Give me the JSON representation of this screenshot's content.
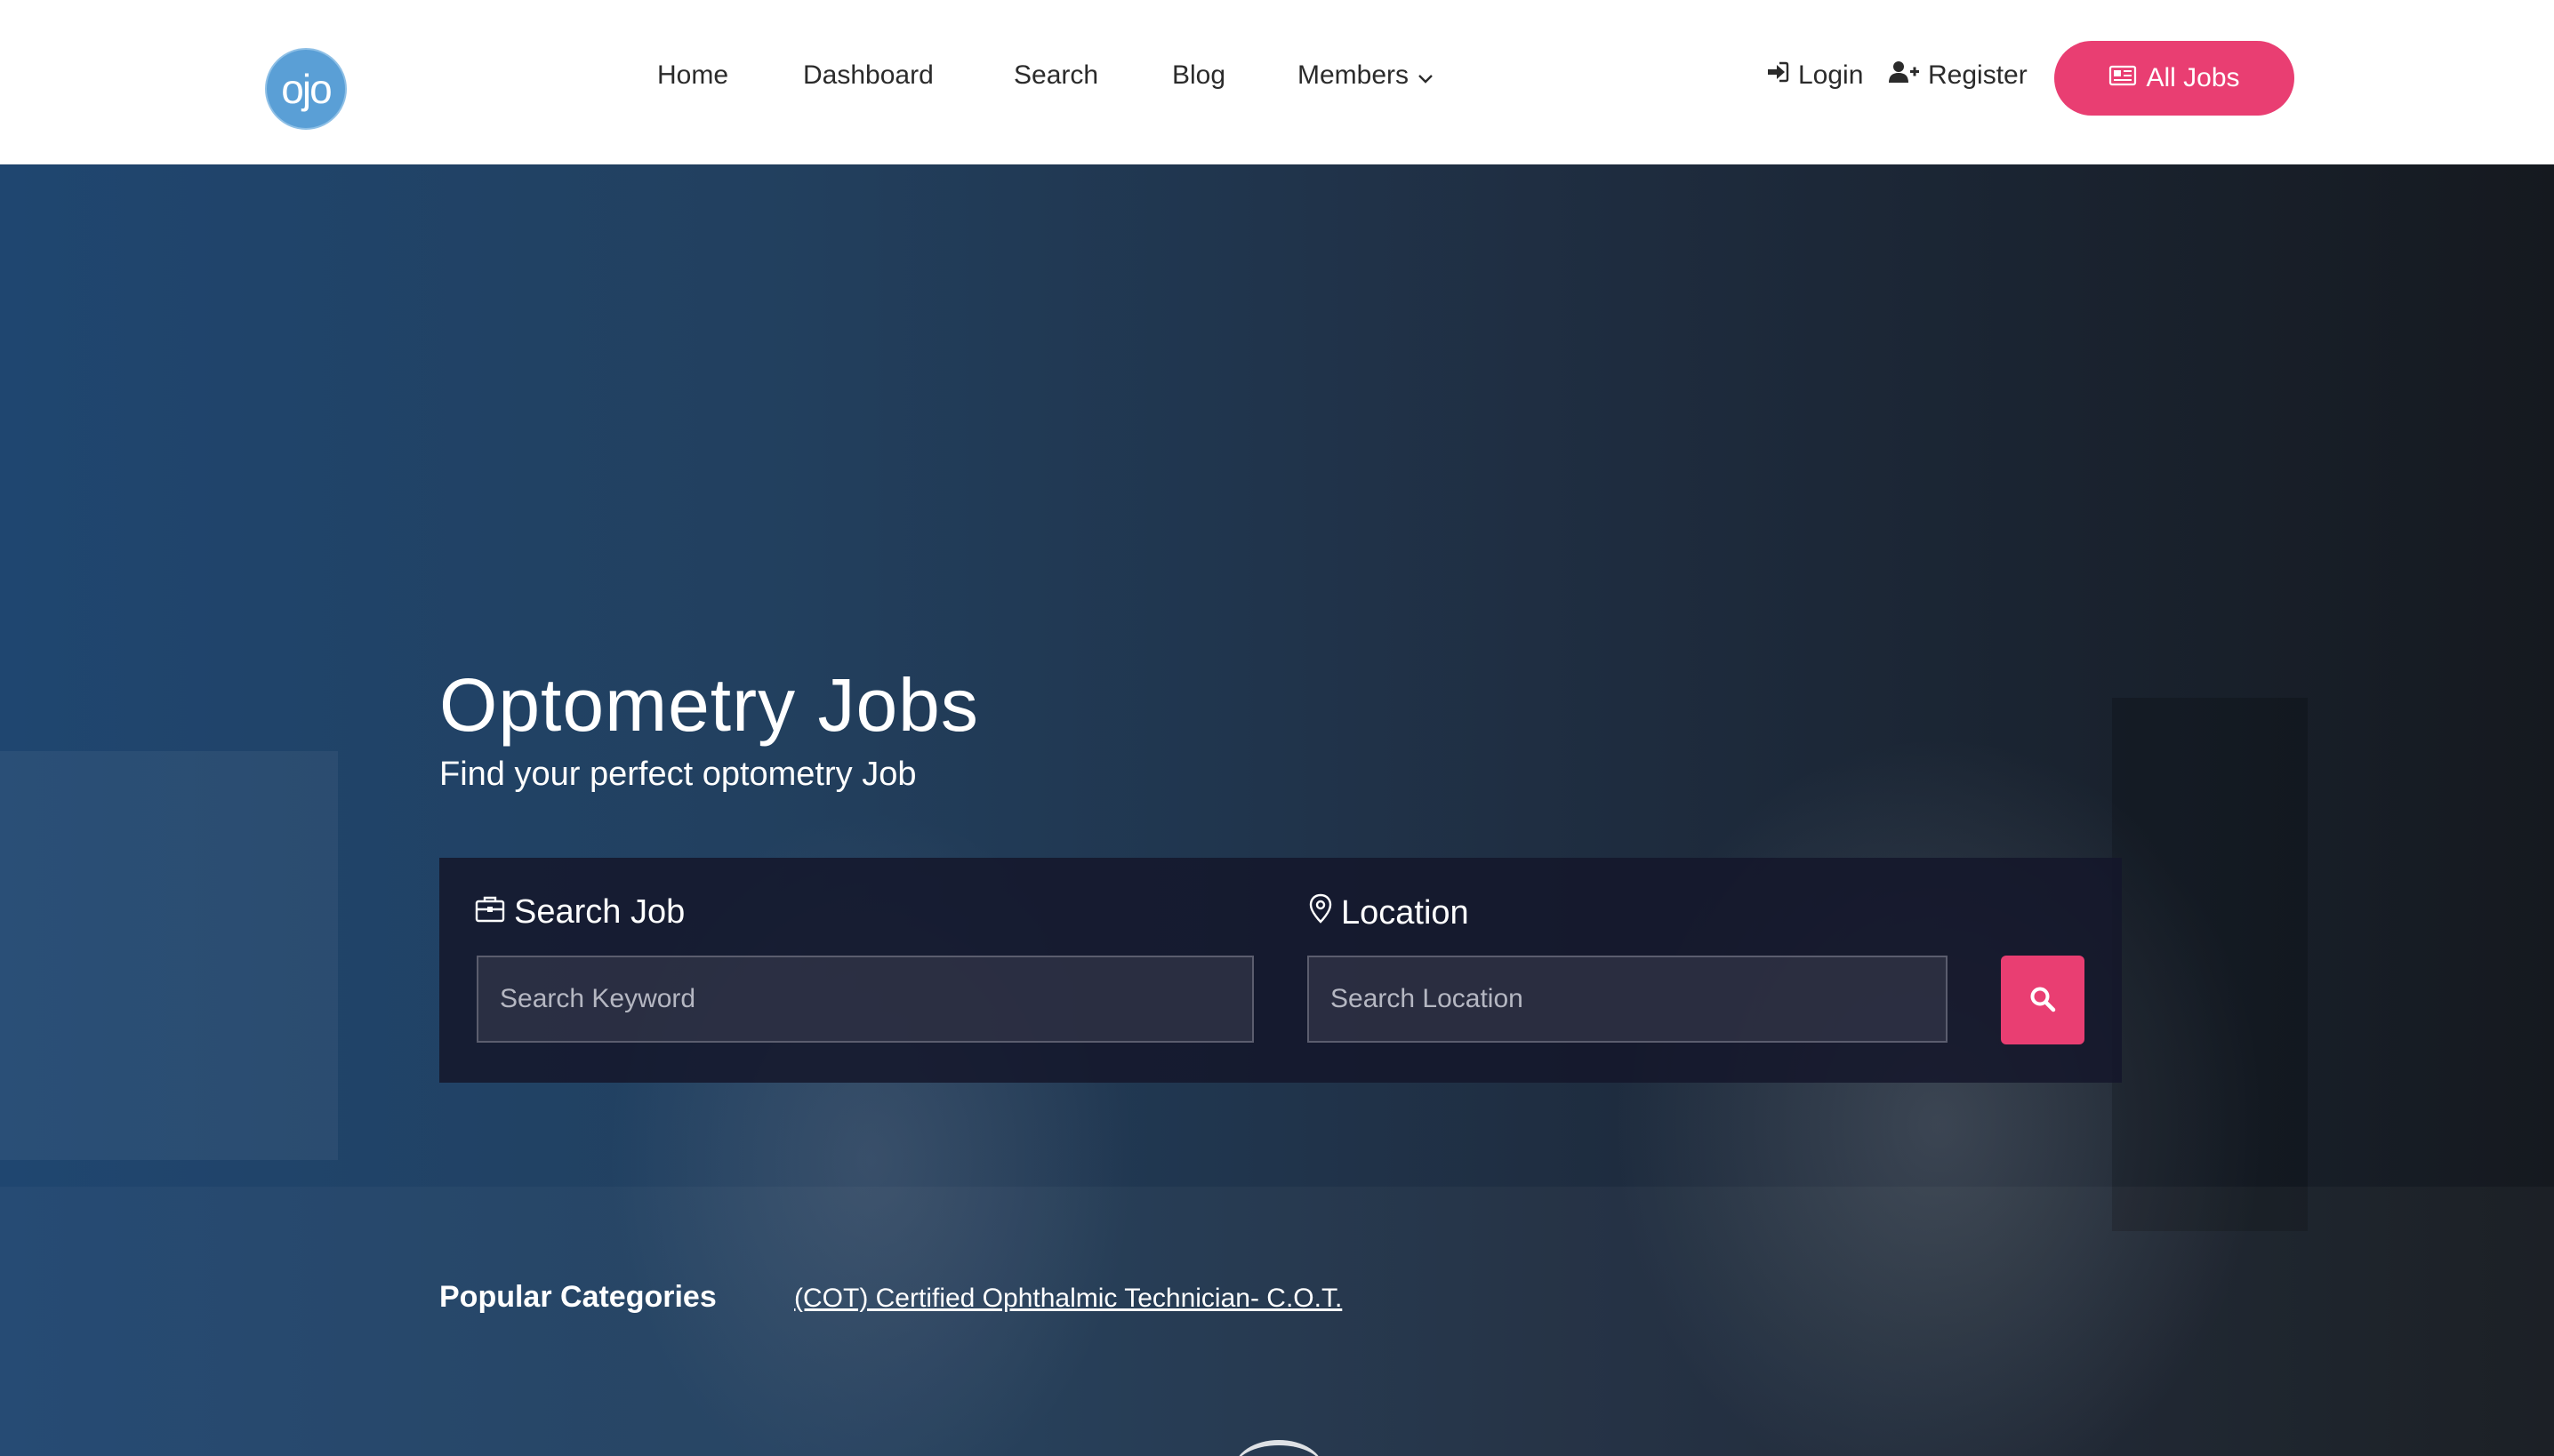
{
  "brand": {
    "logo_text": "ojo"
  },
  "nav": {
    "items": [
      {
        "label": "Home"
      },
      {
        "label": "Dashboard"
      },
      {
        "label": "Search"
      },
      {
        "label": "Blog"
      },
      {
        "label": "Members"
      }
    ]
  },
  "auth": {
    "login_label": "Login",
    "register_label": "Register"
  },
  "cta": {
    "all_jobs_label": "All Jobs"
  },
  "hero": {
    "title": "Optometry Jobs",
    "subtitle": "Find your perfect optometry Job"
  },
  "search": {
    "job_label": "Search Job",
    "job_placeholder": "Search Keyword",
    "location_label": "Location",
    "location_placeholder": "Search Location"
  },
  "popular": {
    "label": "Popular Categories",
    "links": [
      "(COT) Certified Ophthalmic Technician- C.O.T."
    ]
  },
  "colors": {
    "accent": "#e93e72",
    "logo": "#5a9fd6",
    "header_bg": "#ffffff",
    "nav_text": "#2b2b2b"
  },
  "icons": {
    "login": "sign-in-icon",
    "register": "user-plus-icon",
    "all_jobs": "newspaper-icon",
    "search_job": "briefcase-icon",
    "location": "map-pin-icon",
    "search_button": "search-icon",
    "members_dropdown": "chevron-down-icon"
  }
}
